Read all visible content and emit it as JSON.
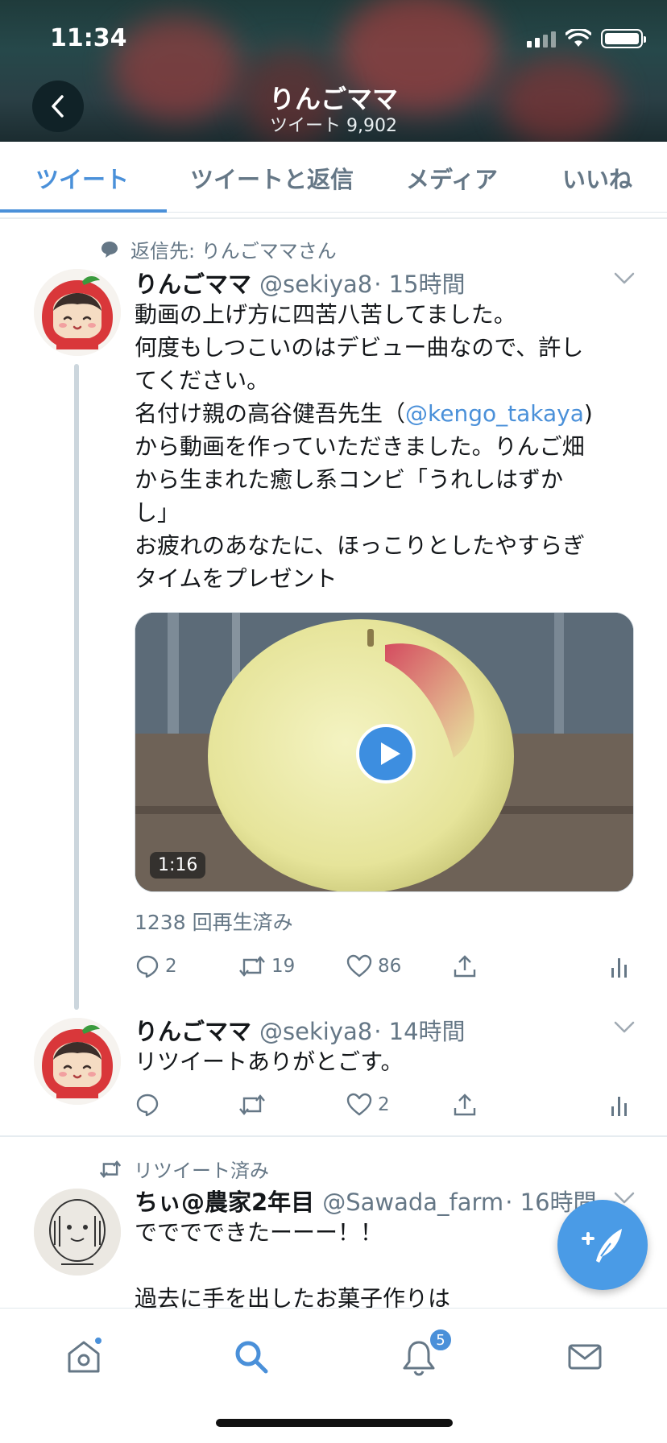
{
  "status_bar": {
    "time": "11:34"
  },
  "header": {
    "title": "りんごママ",
    "subtitle": "ツイート 9,902",
    "back_icon": "chevron-left-icon"
  },
  "tabs": [
    {
      "label": "ツイート",
      "active": true
    },
    {
      "label": "ツイートと返信",
      "active": false
    },
    {
      "label": "メディア",
      "active": false
    },
    {
      "label": "いいね",
      "active": false
    }
  ],
  "tweets": [
    {
      "context": "返信先: りんごママさん",
      "name": "りんごママ",
      "handle": "@sekiya8",
      "time": "· 15時間",
      "lines": [
        "動画の上げ方に四苦八苦してました。",
        "何度もしつこいのはデビュー曲なので、許し",
        "てください。",
        "名付け親の高谷健吾先生（",
        "から動画を作っていただきました。りんご畑",
        "から生まれた癒し系コンビ「うれしはずか",
        "し」",
        "お疲れのあなたに、ほっこりとしたやすらぎ",
        "タイムをプレゼント"
      ],
      "mention": "@kengo_takaya",
      "mention_after": ")",
      "video_duration": "1:16",
      "views": "1238 回再生済み",
      "replies": "2",
      "retweets": "19",
      "likes": "86"
    },
    {
      "name": "りんごママ",
      "handle": "@sekiya8",
      "time": "· 14時間",
      "text": "リツイートありがとごす。",
      "replies": "",
      "retweets": "",
      "likes": "2"
    },
    {
      "context": "リツイート済み",
      "name": "ちぃ@農家2年目",
      "handle": "@Sawada_farm",
      "time": "· 16時間",
      "lines": [
        "でででできたーーー！！",
        "",
        "過去に手を出したお菓子作りは"
      ]
    }
  ],
  "bottom_nav": {
    "notifications_badge": "5"
  },
  "colors": {
    "accent": "#4a90d9",
    "muted": "#657786",
    "fab": "#4a9be6"
  }
}
